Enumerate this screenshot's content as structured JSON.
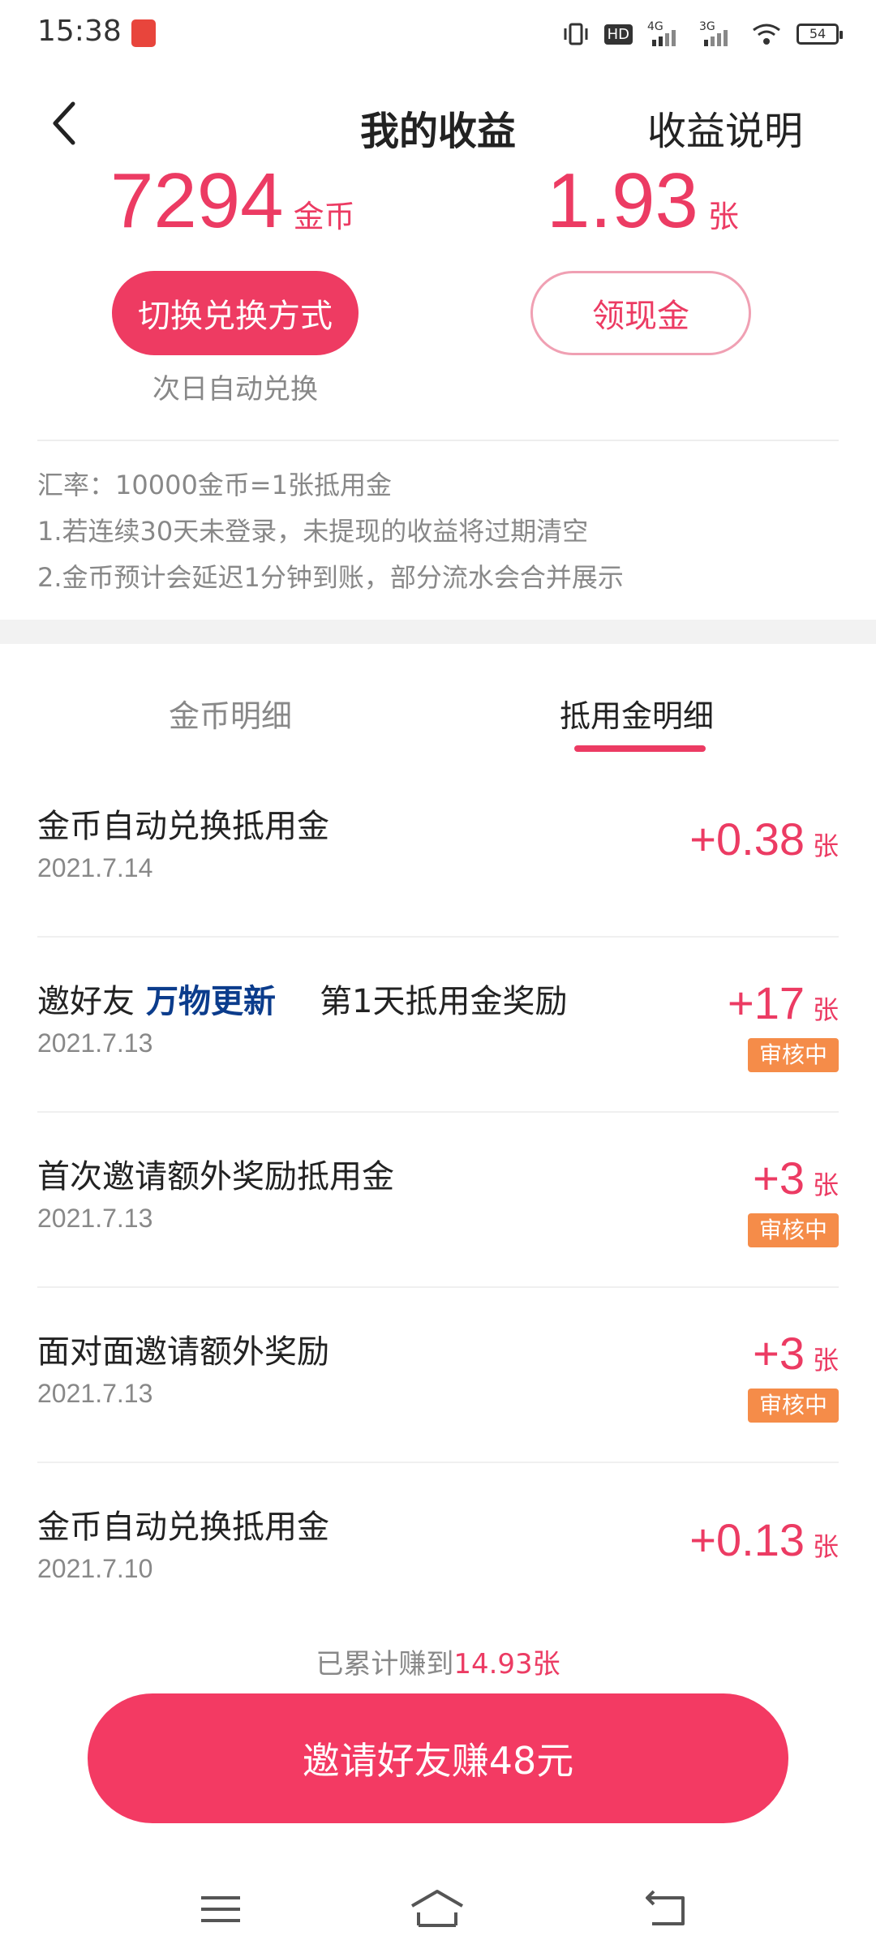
{
  "status_bar": {
    "time": "15:38",
    "battery": "54",
    "network_1": "4G",
    "network_2": "3G",
    "hd": "HD"
  },
  "header": {
    "title": "我的收益",
    "right_link": "收益说明"
  },
  "balance": {
    "coins_value": "7294",
    "coins_unit": "金币",
    "vouchers_value": "1.93",
    "vouchers_unit": "张",
    "switch_button": "切换兑换方式",
    "withdraw_button": "领现金",
    "auto_note": "次日自动兑换"
  },
  "notes": [
    "汇率：10000金币=1张抵用金",
    "1.若连续30天未登录，未提现的收益将过期清空",
    "2.金币预计会延迟1分钟到账，部分流水会合并展示"
  ],
  "tabs": [
    {
      "label": "金币明细",
      "active": false
    },
    {
      "label": "抵用金明细",
      "active": true
    }
  ],
  "records": [
    {
      "title": "金币自动兑换抵用金",
      "date": "2021.7.14",
      "sign": "+",
      "amount": "0.38",
      "unit": "张",
      "badge": ""
    },
    {
      "title_prefix": "邀好友",
      "title_highlight": "万物更新",
      "title_suffix": "第1天抵用金奖励",
      "date": "2021.7.13",
      "sign": "+",
      "amount": "17",
      "unit": "张",
      "badge": "审核中"
    },
    {
      "title": "首次邀请额外奖励抵用金",
      "date": "2021.7.13",
      "sign": "+",
      "amount": "3",
      "unit": "张",
      "badge": "审核中"
    },
    {
      "title": "面对面邀请额外奖励",
      "date": "2021.7.13",
      "sign": "+",
      "amount": "3",
      "unit": "张",
      "badge": "审核中"
    },
    {
      "title": "金币自动兑换抵用金",
      "date": "2021.7.10",
      "sign": "+",
      "amount": "0.13",
      "unit": "张",
      "badge": ""
    }
  ],
  "footer": {
    "earned_prefix": "已累计赚到",
    "earned_value": "14.93张",
    "invite_button": "邀请好友赚48元"
  },
  "colors": {
    "accent": "#ec3b63",
    "highlight": "#0b3c8c",
    "badge": "#f58c49"
  },
  "icons": {
    "back": "back-arrow-icon",
    "menu": "menu-icon",
    "home": "home-icon",
    "nav_back": "nav-back-icon"
  }
}
